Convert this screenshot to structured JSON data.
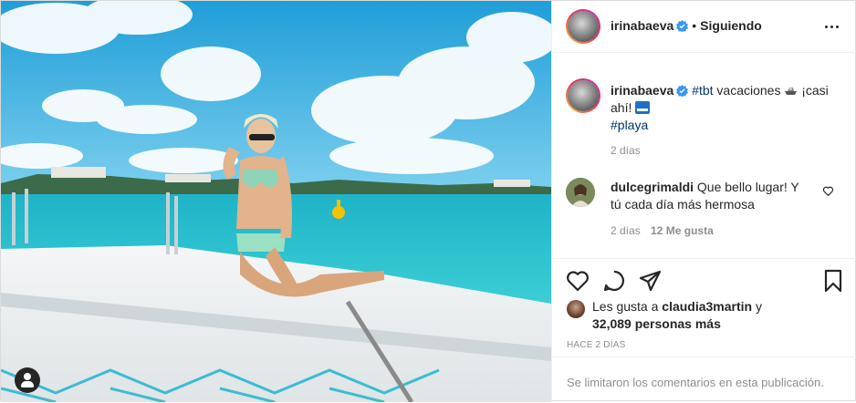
{
  "header": {
    "username": "irinabaeva",
    "separator": "•",
    "follow_status": "Siguiendo"
  },
  "caption": {
    "username": "irinabaeva",
    "hashtag_tbt": "#tbt",
    "text_1": "vacaciones",
    "text_2": "¡casi ahí!",
    "hashtag_playa": "#playa",
    "time": "2 días"
  },
  "comment": {
    "username": "dulcegrimaldi",
    "text": "Que bello lugar! Y tú cada día más hermosa",
    "time": "2 días",
    "likes": "12 Me gusta"
  },
  "liked_by": {
    "prefix": "Les gusta a",
    "user": "claudia3martin",
    "middle": "y",
    "count": "32,089 personas más"
  },
  "posted_ago": "HACE 2 DÍAS",
  "comments_disabled": "Se limitaron los comentarios en esta publicación.",
  "icons": {
    "verified": "verified-badge-icon",
    "more": "more-options-icon",
    "like": "heart-icon",
    "comment": "comment-icon",
    "share": "paper-plane-icon",
    "save": "bookmark-icon",
    "tag": "user-tag-icon"
  },
  "colors": {
    "verified": "#3897f0",
    "hashtag": "#00376b",
    "muted": "#8e8e8e",
    "text": "#262626"
  }
}
